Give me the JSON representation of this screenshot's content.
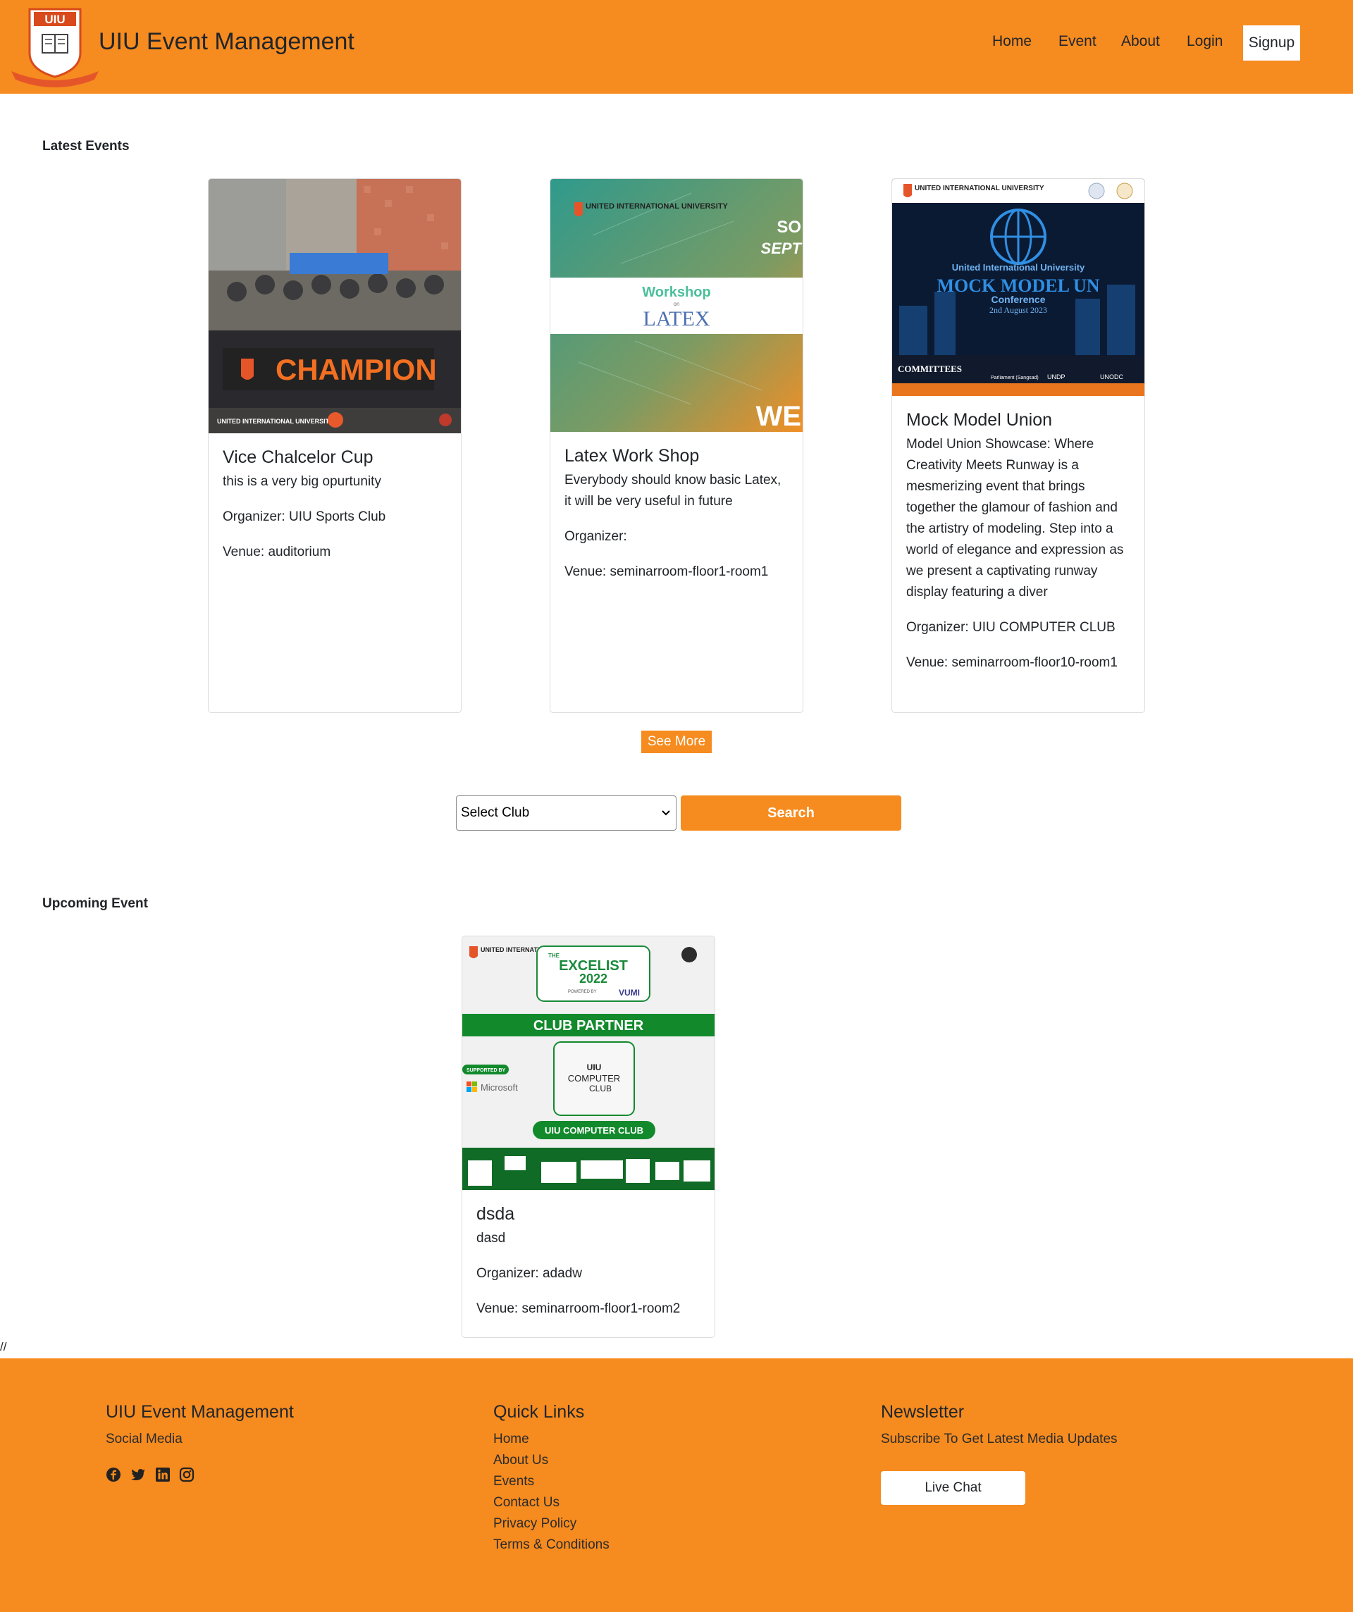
{
  "header": {
    "brand_title": "UIU Event Management",
    "logo_icon": "uiu-crest-logo",
    "nav": {
      "home": "Home",
      "event": "Event",
      "about": "About",
      "login": "Login",
      "signup": "Signup"
    },
    "accent_color": "#f68b1f"
  },
  "latest": {
    "heading": "Latest Events",
    "cards": [
      {
        "title": "Vice Chalcelor Cup",
        "description": "this is a very big opurtunity",
        "organizer": "Organizer: UIU Sports Club",
        "venue": "Venue: auditorium",
        "image_text": "CHAMPION",
        "image_badge": "UNITED INTERNATIONAL UNIVERSITY"
      },
      {
        "title": "Latex Work Shop",
        "description": "Everybody should know basic Latex, it will be very useful in future",
        "organizer": "Organizer:",
        "venue": "Venue: seminarroom-floor1-room1",
        "image_workshop": "Workshop",
        "image_on": "on",
        "image_latex": "LATEX",
        "image_corner_top": "SO",
        "image_corner_mid": "SEPT",
        "image_corner_bottom": "WE",
        "image_badge": "UNITED INTERNATIONAL UNIVERSITY"
      },
      {
        "title": "Mock Model Union",
        "description": "Model Union Showcase: Where Creativity Meets Runway is a mesmerizing event that brings together the glamour of fashion and the artistry of modeling. Step into a world of elegance and expression as we present a captivating runway display featuring a diver",
        "organizer": "Organizer: UIU COMPUTER CLUB",
        "venue": "Venue: seminarroom-floor10-room1",
        "image_line1": "United International University",
        "image_line2": "MOCK MODEL UN",
        "image_line3": "Conference",
        "image_line4": "2nd August 2023",
        "image_committees": "COMMITTEES",
        "image_committee_1": "Parliament (Sangsad)",
        "image_committee_2": "UNDP",
        "image_committee_3": "UNODC",
        "image_badge": "UNITED INTERNATIONAL UNIVERSITY"
      }
    ],
    "see_more": "See More"
  },
  "filter": {
    "select_value": "Select Club",
    "search_label": "Search"
  },
  "upcoming": {
    "heading": "Upcoming Event",
    "cards": [
      {
        "title": "dsda",
        "description": "dasd",
        "organizer": "Organizer: adadw",
        "venue": "Venue: seminarroom-floor1-room2",
        "image_the": "THE",
        "image_excelist": "EXCELIST",
        "image_year": "2022",
        "image_powered": "POWERED BY",
        "image_vumi": "VUMI",
        "image_club_partner": "CLUB PARTNER",
        "image_supported": "SUPPORTED BY",
        "image_microsoft": "Microsoft",
        "image_uiu": "UIU",
        "image_computer": "COMPUTER",
        "image_club": "CLUB",
        "image_club_name": "UIU COMPUTER CLUB",
        "image_badge": "UNITED INTERNATIONAL UNIVERSITY"
      }
    ]
  },
  "stray_text": "//",
  "footer": {
    "col1_title": "UIU Event Management",
    "col1_sub": "Social Media",
    "social_icons": [
      "facebook-icon",
      "twitter-icon",
      "linkedin-icon",
      "instagram-icon"
    ],
    "col2_title": "Quick Links",
    "links": [
      "Home",
      "About Us",
      "Events",
      "Contact Us",
      "Privacy Policy",
      "Terms & Conditions"
    ],
    "col3_title": "Newsletter",
    "col3_sub": "Subscribe To Get Latest Media Updates",
    "live_chat": "Live Chat"
  }
}
